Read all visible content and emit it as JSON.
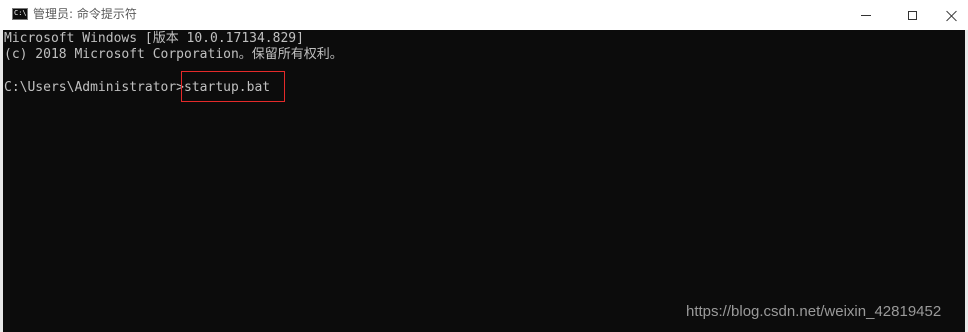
{
  "window": {
    "title": "管理员: 命令提示符",
    "icon": "cmd-icon",
    "icon_text": "C:\\."
  },
  "controls": {
    "minimize": "minimize-icon",
    "maximize": "maximize-icon",
    "close": "close-icon"
  },
  "console": {
    "lines": [
      "Microsoft Windows [版本 10.0.17134.829]",
      "(c) 2018 Microsoft Corporation。保留所有权利。",
      "",
      "C:\\Users\\Administrator>startup.bat"
    ],
    "prompt": "C:\\Users\\Administrator>",
    "command": "startup.bat"
  },
  "colors": {
    "console_background": "#0c0c0c",
    "console_text": "#c0c0c0",
    "highlight_border": "#e52a2a"
  },
  "watermark": "https://blog.csdn.net/weixin_42819452"
}
